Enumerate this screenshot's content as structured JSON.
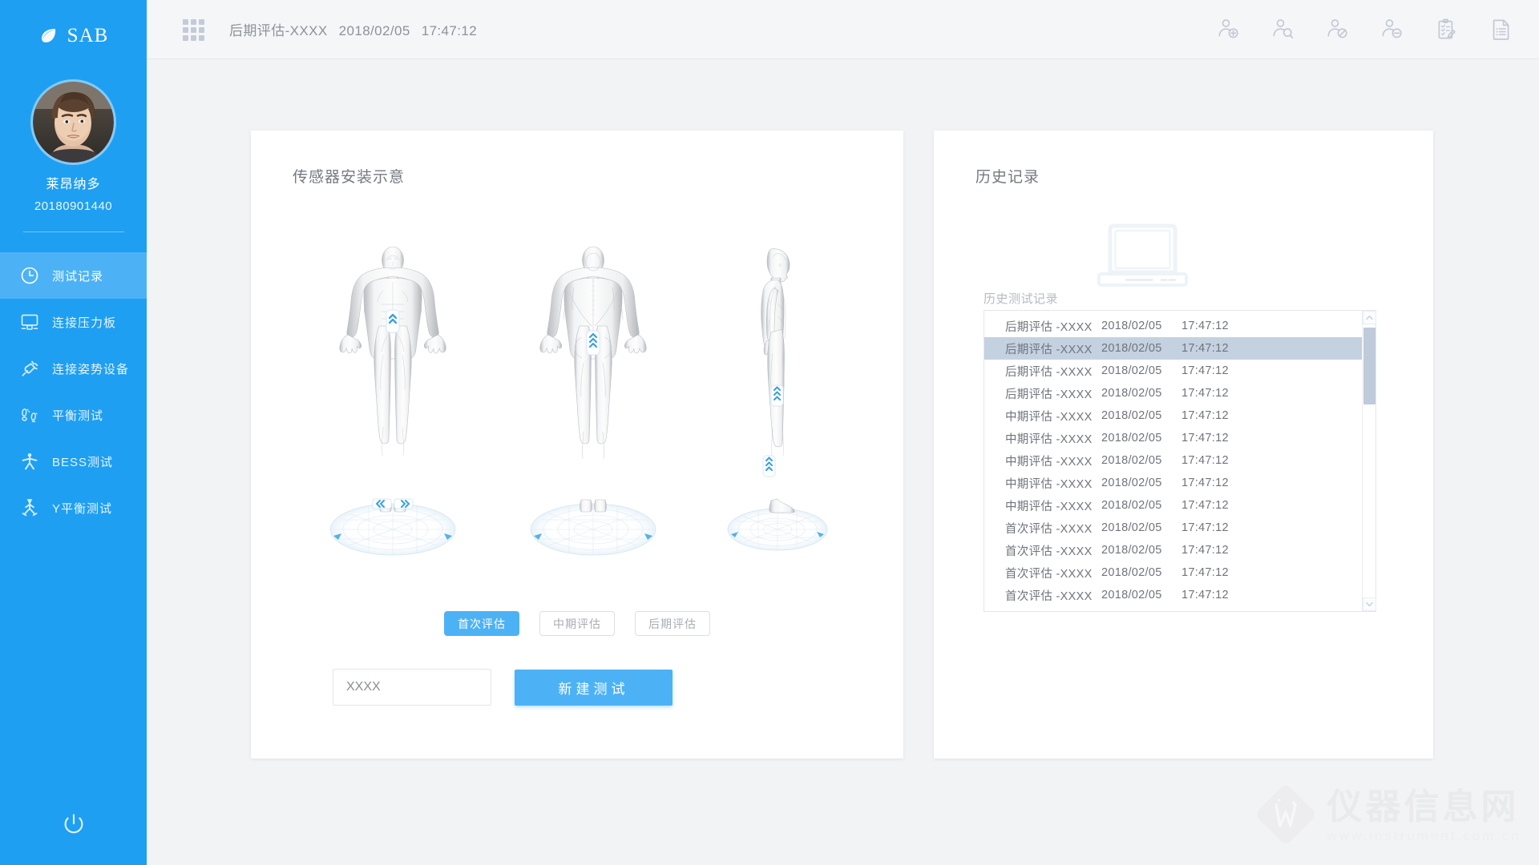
{
  "brand": {
    "name": "SAB",
    "logo_icon": "leaf-icon"
  },
  "user": {
    "name": "莱昂纳多",
    "id": "20180901440",
    "avatar_icon": "user-avatar"
  },
  "sidebar": {
    "items": [
      {
        "label": "测试记录",
        "icon": "clock-icon",
        "active": true
      },
      {
        "label": "连接压力板",
        "icon": "monitor-icon",
        "active": false
      },
      {
        "label": "连接姿势设备",
        "icon": "plug-icon",
        "active": false
      },
      {
        "label": "平衡测试",
        "icon": "footprints-icon",
        "active": false
      },
      {
        "label": "BESS测试",
        "icon": "person-icon",
        "active": false
      },
      {
        "label": "Y平衡测试",
        "icon": "y-balance-icon",
        "active": false
      }
    ],
    "power_label": "power-button"
  },
  "topbar": {
    "grid_icon": "grid-menu-icon",
    "title": "后期评估-XXXX",
    "date": "2018/02/05",
    "time": "17:47:12",
    "actions": [
      {
        "icon": "add-user-icon",
        "name": "新增"
      },
      {
        "icon": "search-user-icon",
        "name": "查询"
      },
      {
        "icon": "edit-user-icon",
        "name": "修改"
      },
      {
        "icon": "remove-user-icon",
        "name": "删除"
      },
      {
        "icon": "clipboard-edit-icon",
        "name": "评估"
      },
      {
        "icon": "document-icon",
        "name": "报告"
      }
    ]
  },
  "sensor_panel": {
    "title": "传感器安装示意",
    "figures": [
      {
        "view": "front",
        "sensors": [
          "chest",
          "left-foot",
          "right-foot"
        ]
      },
      {
        "view": "back",
        "sensors": [
          "lower-back"
        ]
      },
      {
        "view": "side",
        "sensors": [
          "thigh",
          "calf"
        ]
      }
    ],
    "phases": [
      {
        "label": "首次评估",
        "selected": true
      },
      {
        "label": "中期评估",
        "selected": false
      },
      {
        "label": "后期评估",
        "selected": false
      }
    ],
    "name_value": "XXXX",
    "name_placeholder": "XXXX",
    "create_label": "新建测试"
  },
  "history_panel": {
    "title": "历史记录",
    "empty_icon": "laptop-icon",
    "sublabel": "历史测试记录",
    "rows": [
      {
        "name": "后期评估 -XXXX",
        "date": "2018/02/05",
        "time": "17:47:12",
        "selected": false
      },
      {
        "name": "后期评估 -XXXX",
        "date": "2018/02/05",
        "time": "17:47:12",
        "selected": true
      },
      {
        "name": "后期评估 -XXXX",
        "date": "2018/02/05",
        "time": "17:47:12",
        "selected": false
      },
      {
        "name": "后期评估 -XXXX",
        "date": "2018/02/05",
        "time": "17:47:12",
        "selected": false
      },
      {
        "name": "中期评估 -XXXX",
        "date": "2018/02/05",
        "time": "17:47:12",
        "selected": false
      },
      {
        "name": "中期评估 -XXXX",
        "date": "2018/02/05",
        "time": "17:47:12",
        "selected": false
      },
      {
        "name": "中期评估 -XXXX",
        "date": "2018/02/05",
        "time": "17:47:12",
        "selected": false
      },
      {
        "name": "中期评估 -XXXX",
        "date": "2018/02/05",
        "time": "17:47:12",
        "selected": false
      },
      {
        "name": "中期评估 -XXXX",
        "date": "2018/02/05",
        "time": "17:47:12",
        "selected": false
      },
      {
        "name": "首次评估 -XXXX",
        "date": "2018/02/05",
        "time": "17:47:12",
        "selected": false
      },
      {
        "name": "首次评估 -XXXX",
        "date": "2018/02/05",
        "time": "17:47:12",
        "selected": false
      },
      {
        "name": "首次评估 -XXXX",
        "date": "2018/02/05",
        "time": "17:47:12",
        "selected": false
      },
      {
        "name": "首次评估 -XXXX",
        "date": "2018/02/05",
        "time": "17:47:12",
        "selected": false
      }
    ]
  },
  "watermark": {
    "cn": "仪器信息网",
    "en": "www.instrument.com.cn"
  },
  "colors": {
    "sidebar": "#1e9ff2",
    "sidebar_active": "#4db2f5",
    "accent": "#4db2f5",
    "page_bg": "#f2f3f5",
    "panel_bg": "#ffffff",
    "row_selected": "#c4d1e0",
    "text_muted": "#8d9299"
  }
}
